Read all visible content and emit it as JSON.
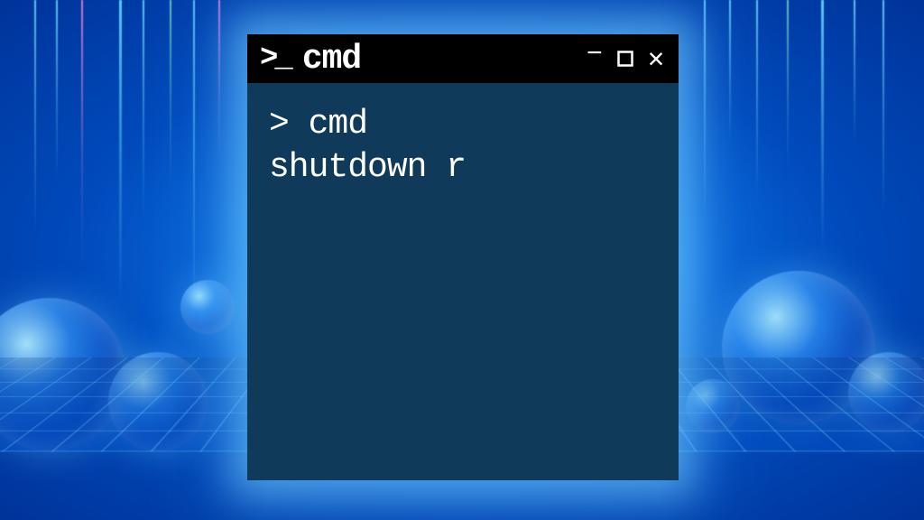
{
  "window": {
    "title": "cmd",
    "icon_glyph": ">_"
  },
  "controls": {
    "minimize": "−",
    "close": "✕"
  },
  "terminal": {
    "prompt": ">",
    "lines": [
      "> cmd",
      "shutdown r"
    ]
  },
  "colors": {
    "titlebar_bg": "#000000",
    "body_bg": "#0f3a5a",
    "text": "#ffffff",
    "glow": "#66ccff"
  }
}
